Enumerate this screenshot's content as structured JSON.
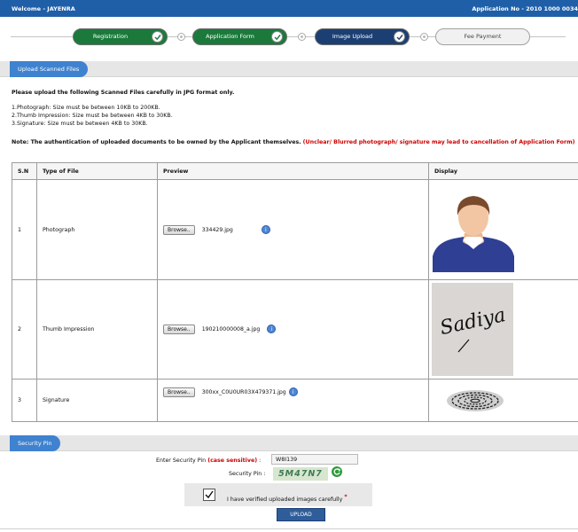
{
  "header": {
    "welcome": "Welcome - JAYENRA",
    "application_no": "Application No - 2010 1000 0034"
  },
  "steps": [
    {
      "label": "Registration",
      "state": "completed",
      "color": "#1b7a3b"
    },
    {
      "label": "Application Form",
      "state": "completed",
      "color": "#1b7a3b"
    },
    {
      "label": "Image Upload",
      "state": "current",
      "color": "#1c3f73"
    },
    {
      "label": "Fee Payment",
      "state": "pending",
      "color": "#f1f1f1"
    }
  ],
  "upload_section": {
    "title": "Upload Scanned Files",
    "intro": "Please upload the following Scanned Files carefully in JPG format only.",
    "rules": [
      "1.Photograph: Size must be between 10KB to 200KB.",
      "2.Thumb Impression: Size must be between 4KB to 30KB.",
      "3.Signature: Size must be between 4KB to 30KB."
    ],
    "note_prefix": "Note: The authentication of uploaded documents to be owned by the Applicant themselves.",
    "note_warning": "(Unclear/ Blurred photograph/ signature may lead to cancellation of Application Form)"
  },
  "files_table": {
    "headers": [
      "S.N",
      "Type of File",
      "Preview",
      "Display"
    ],
    "browse_label": "Browse..",
    "info_icon": "i",
    "rows": [
      {
        "sn": "1",
        "type": "Photograph",
        "file": "334429.jpg",
        "display": "person-avatar"
      },
      {
        "sn": "2",
        "type": "Thumb Impression",
        "file": "190210000008_a.jpg",
        "display": "signature-image"
      },
      {
        "sn": "3",
        "type": "Signature",
        "file": "300xx_C0U0UR03X479371.jpg",
        "display": "fingerprint-image"
      }
    ]
  },
  "signature_text": "Sadiya",
  "security_section": {
    "title": "Security Pin",
    "enter_label": "Enter Security Pin",
    "case_note": "(case sensitive)",
    "colon": ":",
    "input_value": "W8I139",
    "pin_label": "Security Pin :",
    "captcha": "5M47N7",
    "verify_text": "I have verified uploaded images carefully",
    "required_mark": "*",
    "upload_button": "UPLOAD"
  }
}
